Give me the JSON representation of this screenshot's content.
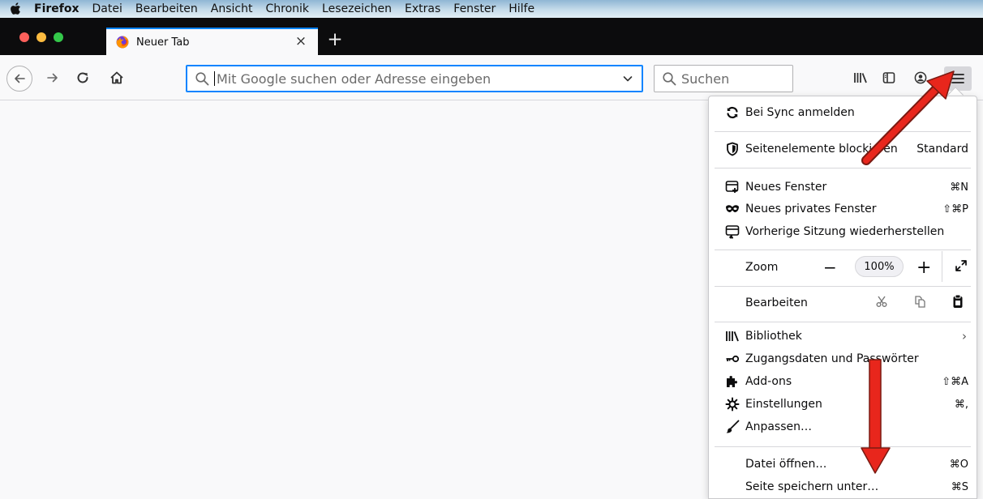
{
  "menubar": {
    "apple_icon": "apple-logo-icon",
    "app_name": "Firefox",
    "items": [
      "Datei",
      "Bearbeiten",
      "Ansicht",
      "Chronik",
      "Lesezeichen",
      "Extras",
      "Fenster",
      "Hilfe"
    ]
  },
  "tabbar": {
    "tab_title": "Neuer Tab",
    "close_glyph": "×",
    "new_tab_glyph": "+"
  },
  "navbar": {
    "urlbar_placeholder": "Mit Google suchen oder Adresse eingeben",
    "search_placeholder": "Suchen"
  },
  "app_menu": {
    "sync": "Bei Sync anmelden",
    "content_blocking": {
      "label": "Seitenelemente blockieren",
      "value": "Standard"
    },
    "new_window": {
      "label": "Neues Fenster",
      "shortcut": "⌘N"
    },
    "new_private_window": {
      "label": "Neues privates Fenster",
      "shortcut": "⇧⌘P"
    },
    "restore_session": "Vorherige Sitzung wiederherstellen",
    "zoom": {
      "label": "Zoom",
      "minus": "−",
      "value": "100%",
      "plus": "+"
    },
    "edit": {
      "label": "Bearbeiten"
    },
    "library": "Bibliothek",
    "logins": "Zugangsdaten und Passwörter",
    "addons": {
      "label": "Add-ons",
      "shortcut": "⇧⌘A"
    },
    "preferences": {
      "label": "Einstellungen",
      "shortcut": "⌘,"
    },
    "customize": "Anpassen…",
    "open_file": {
      "label": "Datei öffnen…",
      "shortcut": "⌘O"
    },
    "save_page": {
      "label": "Seite speichern unter…",
      "shortcut": "⌘S"
    }
  },
  "colors": {
    "accent": "#0a84ff",
    "tabstrip": "#0c0c0d",
    "annotation_arrow": "#e8261c"
  }
}
